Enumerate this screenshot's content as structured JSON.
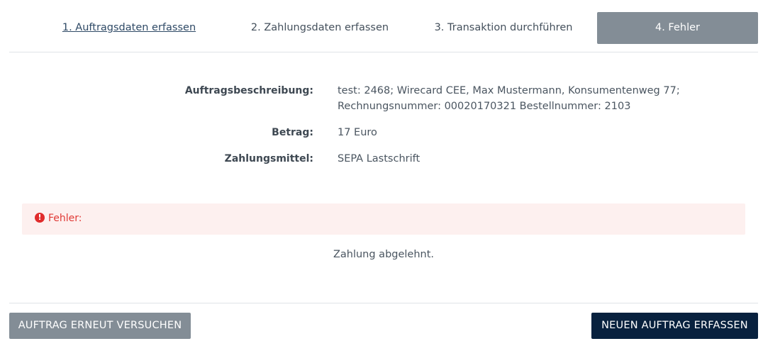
{
  "steps": {
    "step1": "1. Auftragsdaten erfassen",
    "step2": "2. Zahlungsdaten erfassen",
    "step3": "3. Transaktion durchführen",
    "step4": "4. Fehler"
  },
  "details": {
    "description_label": "Auftragsbeschreibung:",
    "description_line1": "test: 2468; Wirecard CEE, Max Mustermann, Konsumentenweg 77;",
    "description_line2": "Rechnungsnummer: 00020170321 Bestellnummer: 2103",
    "amount_label": "Betrag:",
    "amount_value": "17 Euro",
    "payment_label": "Zahlungsmittel:",
    "payment_value": "SEPA Lastschrift"
  },
  "error": {
    "icon": "exclamation-circle-icon",
    "icon_glyph": "!",
    "label": "Fehler:",
    "message": "Zahlung abgelehnt.",
    "color": "#e03a36"
  },
  "actions": {
    "retry_label": "AUFTRAG ERNEUT VERSUCHEN",
    "new_label": "NEUEN AUFTRAG ERFASSEN"
  },
  "colors": {
    "active_step_bg": "#838d96",
    "primary_button": "#08213e",
    "secondary_button": "#838d96",
    "error_bg": "#fdf0ef"
  }
}
